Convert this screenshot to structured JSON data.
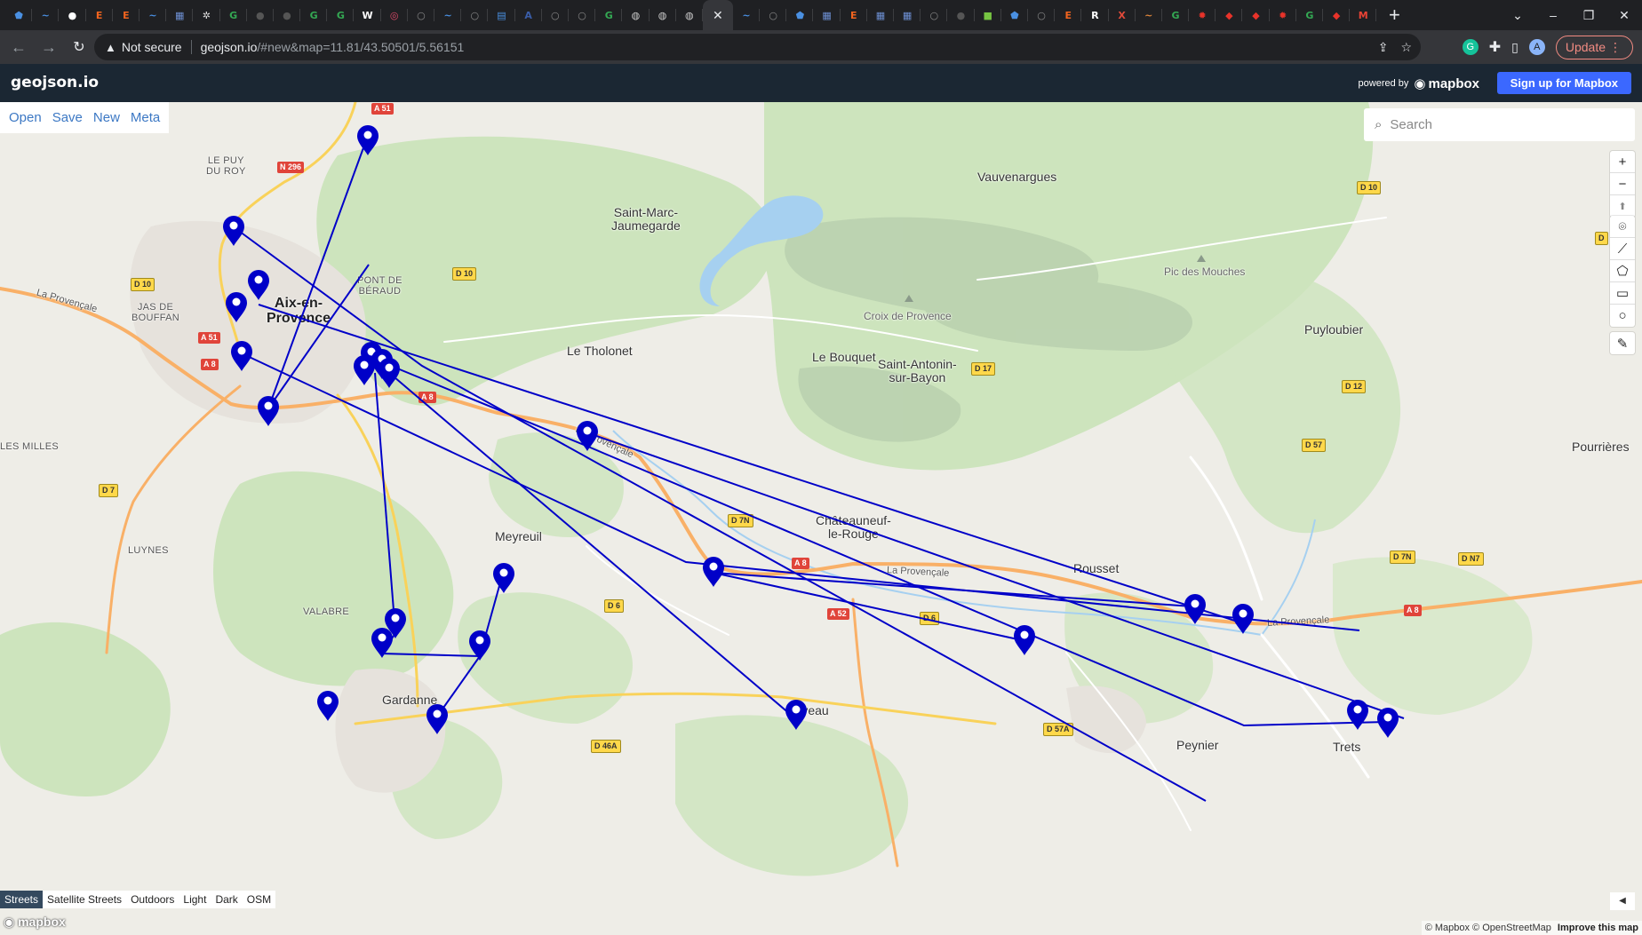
{
  "browser": {
    "tab_favicons": [
      {
        "icon": "shield-icon",
        "color": "#4a90e2",
        "glyph": "⬟"
      },
      {
        "icon": "dash-icon",
        "color": "#4a90e2",
        "glyph": "~"
      },
      {
        "icon": "github-icon",
        "color": "#fff",
        "glyph": "●"
      },
      {
        "icon": "etsy-icon",
        "color": "#f1641e",
        "glyph": "E"
      },
      {
        "icon": "etsy-icon",
        "color": "#f1641e",
        "glyph": "E"
      },
      {
        "icon": "dash-icon",
        "color": "#4a90e2",
        "glyph": "~"
      },
      {
        "icon": "ieee-icon",
        "color": "#6d8fd2",
        "glyph": "▦"
      },
      {
        "icon": "gear-icon",
        "color": "#ddd",
        "glyph": "✲"
      },
      {
        "icon": "google-icon",
        "color": "#34a853",
        "glyph": "G"
      },
      {
        "icon": "github-icon",
        "color": "#555",
        "glyph": "●"
      },
      {
        "icon": "github-icon",
        "color": "#555",
        "glyph": "●"
      },
      {
        "icon": "google-icon",
        "color": "#34a853",
        "glyph": "G"
      },
      {
        "icon": "google-icon",
        "color": "#34a853",
        "glyph": "G"
      },
      {
        "icon": "wikipedia-icon",
        "color": "#fff",
        "glyph": "W"
      },
      {
        "icon": "swirl-icon",
        "color": "#e04a6a",
        "glyph": "◎"
      },
      {
        "icon": "globe-icon",
        "color": "#888",
        "glyph": "○"
      },
      {
        "icon": "dash-icon",
        "color": "#4a90e2",
        "glyph": "~"
      },
      {
        "icon": "globe-icon",
        "color": "#888",
        "glyph": "○"
      },
      {
        "icon": "docs-icon",
        "color": "#4a90e2",
        "glyph": "▤"
      },
      {
        "icon": "atsb-icon",
        "color": "#3a5da8",
        "glyph": "A"
      },
      {
        "icon": "globe-icon",
        "color": "#888",
        "glyph": "○"
      },
      {
        "icon": "globe-icon",
        "color": "#888",
        "glyph": "○"
      },
      {
        "icon": "google-icon",
        "color": "#34a853",
        "glyph": "G"
      },
      {
        "icon": "gj-icon",
        "color": "#ccc",
        "glyph": "◍"
      },
      {
        "icon": "gj-icon",
        "color": "#ccc",
        "glyph": "◍"
      },
      {
        "icon": "gj-icon",
        "color": "#ccc",
        "glyph": "◍"
      }
    ],
    "tab_favicons_after": [
      {
        "icon": "dash-icon",
        "color": "#4a90e2",
        "glyph": "~"
      },
      {
        "icon": "globe-icon",
        "color": "#888",
        "glyph": "○"
      },
      {
        "icon": "shield-icon",
        "color": "#4a90e2",
        "glyph": "⬟"
      },
      {
        "icon": "ieee-icon",
        "color": "#6d8fd2",
        "glyph": "▦"
      },
      {
        "icon": "etsy-icon",
        "color": "#f1641e",
        "glyph": "E"
      },
      {
        "icon": "ieee-icon",
        "color": "#6d8fd2",
        "glyph": "▦"
      },
      {
        "icon": "ieee-icon",
        "color": "#6d8fd2",
        "glyph": "▦"
      },
      {
        "icon": "globe-icon",
        "color": "#888",
        "glyph": "○"
      },
      {
        "icon": "github-icon",
        "color": "#555",
        "glyph": "●"
      },
      {
        "icon": "green-square-icon",
        "color": "#76c442",
        "glyph": "■"
      },
      {
        "icon": "shield-icon",
        "color": "#4a90e2",
        "glyph": "⬟"
      },
      {
        "icon": "globe-icon",
        "color": "#888",
        "glyph": "○"
      },
      {
        "icon": "etsy-icon",
        "color": "#f1641e",
        "glyph": "E"
      },
      {
        "icon": "r-icon",
        "color": "#fff",
        "glyph": "R"
      },
      {
        "icon": "x-icon",
        "color": "#e04a3a",
        "glyph": "X"
      },
      {
        "icon": "dash-icon",
        "color": "#e0863a",
        "glyph": "~"
      },
      {
        "icon": "google-icon",
        "color": "#34a853",
        "glyph": "G"
      },
      {
        "icon": "red-gear-icon",
        "color": "#e8332a",
        "glyph": "✹"
      },
      {
        "icon": "red-cube-icon",
        "color": "#e8332a",
        "glyph": "◆"
      },
      {
        "icon": "red-cube-icon",
        "color": "#e8332a",
        "glyph": "◆"
      },
      {
        "icon": "red-gear-icon",
        "color": "#e8332a",
        "glyph": "✹"
      },
      {
        "icon": "google-icon",
        "color": "#34a853",
        "glyph": "G"
      },
      {
        "icon": "red-cube-icon",
        "color": "#e8332a",
        "glyph": "◆"
      },
      {
        "icon": "gmail-icon",
        "color": "#ea4335",
        "glyph": "M"
      }
    ],
    "active_tab_close": "✕",
    "new_tab": "+",
    "not_secure": "Not secure",
    "url_host": "geojson.io",
    "url_rest": "/#new&map=11.81/43.50501/5.56151",
    "update_label": "Update",
    "profile_initial": "A"
  },
  "app": {
    "brand": "geojson.io",
    "powered_by": "powered by",
    "mapbox": "mapbox",
    "signup": "Sign up for Mapbox",
    "menu": [
      "Open",
      "Save",
      "New",
      "Meta"
    ],
    "search_placeholder": "Search",
    "zoom_in": "+",
    "zoom_out": "−",
    "compass": "⬆",
    "draw_tools": [
      "marker-icon",
      "line-icon",
      "polygon-icon",
      "rectangle-icon",
      "circle-icon"
    ],
    "edit_tool": "edit-icon",
    "layers": [
      "Streets",
      "Satellite Streets",
      "Outdoors",
      "Light",
      "Dark",
      "OSM"
    ],
    "active_layer": "Streets",
    "mapbox_logo": "mapbox",
    "attribution": "© Mapbox © OpenStreetMap",
    "improve": "Improve this map"
  },
  "map": {
    "places": [
      {
        "text": "LE PUY\nDU ROY",
        "cls": "small"
      },
      {
        "text": "JAS DE\nBOUFFAN",
        "cls": "small"
      },
      {
        "text": "Aix-en-\nProvence",
        "cls": "big"
      },
      {
        "text": "PONT DE\nBÉRAUD",
        "cls": "small"
      },
      {
        "text": "Saint-Marc-\nJaumegarde",
        "cls": "mid"
      },
      {
        "text": "Vauvenargues",
        "cls": "mid"
      },
      {
        "text": "Pic des Mouches",
        "cls": "peak"
      },
      {
        "text": "Croix de Provence",
        "cls": "peak"
      },
      {
        "text": "Le Tholonet",
        "cls": "mid"
      },
      {
        "text": "Le Bouquet",
        "cls": "mid"
      },
      {
        "text": "Saint-Antonin-\nsur-Bayon",
        "cls": "mid"
      },
      {
        "text": "Puyloubier",
        "cls": "mid"
      },
      {
        "text": "LES MILLES",
        "cls": "small"
      },
      {
        "text": "Pourrières",
        "cls": "mid"
      },
      {
        "text": "Châteauneuf-\nle-Rouge",
        "cls": "mid"
      },
      {
        "text": "Meyreuil",
        "cls": "mid"
      },
      {
        "text": "LUYNES",
        "cls": "small"
      },
      {
        "text": "VALABRE",
        "cls": "small"
      },
      {
        "text": "Rousset",
        "cls": "mid"
      },
      {
        "text": "Gardanne",
        "cls": "mid"
      },
      {
        "text": "Fuveau",
        "cls": "mid"
      },
      {
        "text": "Peynier",
        "cls": "mid"
      },
      {
        "text": "Trets",
        "cls": "mid"
      }
    ],
    "shields": [
      {
        "text": "A 51",
        "type": "red"
      },
      {
        "text": "N 296",
        "type": "red"
      },
      {
        "text": "D 10",
        "type": "yellow"
      },
      {
        "text": "D 10",
        "type": "yellow"
      },
      {
        "text": "A 51",
        "type": "red"
      },
      {
        "text": "A 8",
        "type": "red"
      },
      {
        "text": "A 8",
        "type": "red"
      },
      {
        "text": "D 10",
        "type": "yellow"
      },
      {
        "text": "D 17",
        "type": "yellow"
      },
      {
        "text": "D 12",
        "type": "yellow"
      },
      {
        "text": "D 57",
        "type": "yellow"
      },
      {
        "text": "D 7",
        "type": "yellow"
      },
      {
        "text": "D 7N",
        "type": "yellow"
      },
      {
        "text": "A 8",
        "type": "red"
      },
      {
        "text": "D 7N",
        "type": "yellow"
      },
      {
        "text": "D N7",
        "type": "yellow"
      },
      {
        "text": "D 6",
        "type": "yellow"
      },
      {
        "text": "A 52",
        "type": "red"
      },
      {
        "text": "D 6",
        "type": "yellow"
      },
      {
        "text": "A 8",
        "type": "red"
      },
      {
        "text": "D 46A",
        "type": "yellow"
      },
      {
        "text": "D 57A",
        "type": "yellow"
      },
      {
        "text": "D",
        "type": "yellow"
      }
    ],
    "road_labels": [
      "La Provençale",
      "La Provençale",
      "La Provençale",
      "La Provençale"
    ]
  }
}
